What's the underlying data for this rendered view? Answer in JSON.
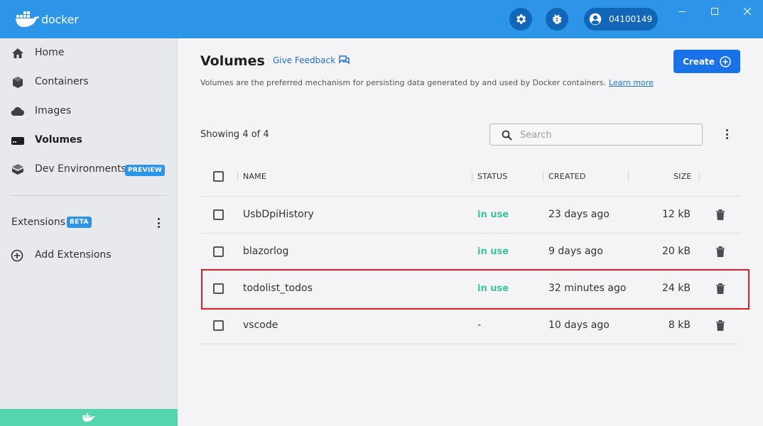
{
  "app": {
    "logo_text": "docker",
    "account_name": "04100149"
  },
  "sidebar": {
    "items": [
      {
        "label": "Home",
        "icon": "home-icon",
        "active": false
      },
      {
        "label": "Containers",
        "icon": "containers-icon",
        "active": false
      },
      {
        "label": "Images",
        "icon": "cloud-icon",
        "active": false
      },
      {
        "label": "Volumes",
        "icon": "volume-drive-icon",
        "active": true
      },
      {
        "label": "Dev Environments",
        "icon": "dev-environments-icon",
        "active": false,
        "badge": "PREVIEW"
      }
    ],
    "extensions_label": "Extensions",
    "extensions_badge": "BETA",
    "add_extensions_label": "Add Extensions"
  },
  "main": {
    "title": "Volumes",
    "feedback_label": "Give Feedback",
    "create_label": "Create",
    "description": "Volumes are the preferred mechanism for persisting data generated by and used by Docker containers.",
    "learn_more": "Learn more",
    "showing": "Showing 4 of 4",
    "search_placeholder": "Search",
    "columns": {
      "name": "NAME",
      "status": "STATUS",
      "created": "CREATED",
      "size": "SIZE"
    },
    "rows": [
      {
        "name": "UsbDpiHistory",
        "status": "in use",
        "created": "23 days ago",
        "size": "12 kB"
      },
      {
        "name": "blazorlog",
        "status": "in use",
        "created": "9 days ago",
        "size": "20 kB"
      },
      {
        "name": "todolist_todos",
        "status": "in use",
        "created": "32 minutes ago",
        "size": "24 kB"
      },
      {
        "name": "vscode",
        "status": "-",
        "created": "10 days ago",
        "size": "8 kB"
      }
    ]
  },
  "colors": {
    "topbar": "#2c95e8",
    "primary_button": "#1a72e8",
    "status_in_use": "#3ec49a",
    "highlight": "#e02020",
    "sidebar_bottom": "#56d4b0"
  }
}
